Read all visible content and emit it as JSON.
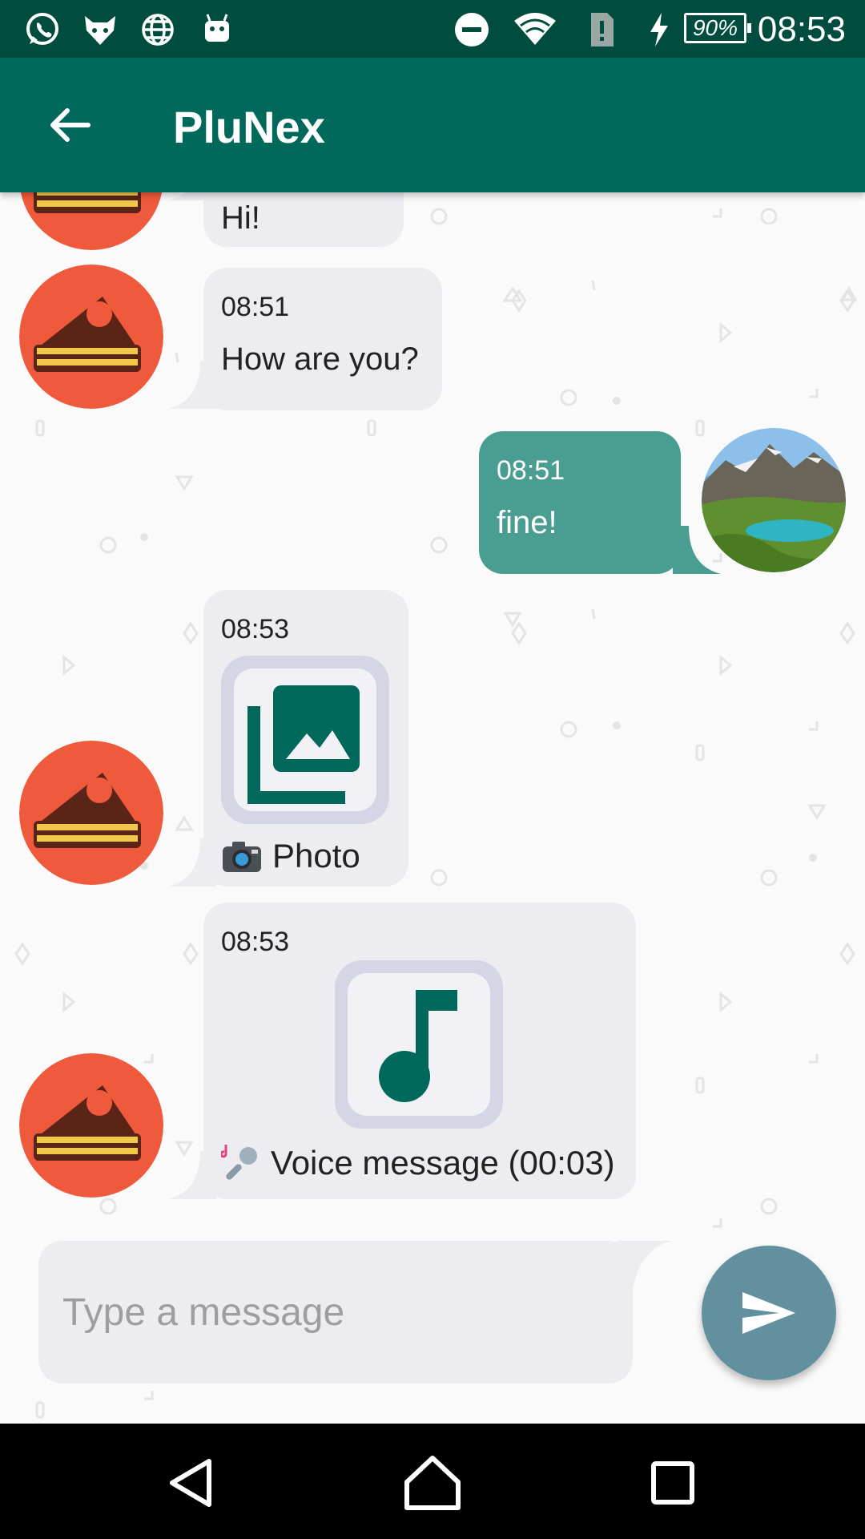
{
  "status_bar": {
    "icons": [
      "whatsapp-icon",
      "fox-icon",
      "globe-icon",
      "android-icon",
      "do-not-disturb-icon",
      "wifi-icon",
      "sim-alert-icon",
      "charging-icon"
    ],
    "battery": "90%",
    "time": "08:53"
  },
  "app_bar": {
    "title": "PluNex",
    "back_icon": "arrow-back-icon"
  },
  "messages": [
    {
      "direction": "in",
      "time": "",
      "text": "Hi!"
    },
    {
      "direction": "in",
      "time": "08:51",
      "text": "How are you?"
    },
    {
      "direction": "out",
      "time": "08:51",
      "text": "fine!"
    },
    {
      "direction": "in",
      "time": "08:53",
      "attachment": "photo-icon",
      "caption": "Photo",
      "caption_emoji": "camera-emoji"
    },
    {
      "direction": "in",
      "time": "08:53",
      "attachment": "music-note-icon",
      "caption": "Voice message (00:03)",
      "caption_emoji": "microphone-emoji"
    }
  ],
  "composer": {
    "placeholder": "Type a message",
    "send_icon": "send-icon"
  },
  "nav_bar": {
    "buttons": [
      "back-triangle-icon",
      "home-icon",
      "recents-icon"
    ]
  },
  "colors": {
    "status_bar": "#004d40",
    "app_bar": "#00695c",
    "bubble_in": "#ececf1",
    "bubble_out": "#4a9e91",
    "send_button": "#62909f",
    "avatar_bg": "#f05a3c"
  }
}
